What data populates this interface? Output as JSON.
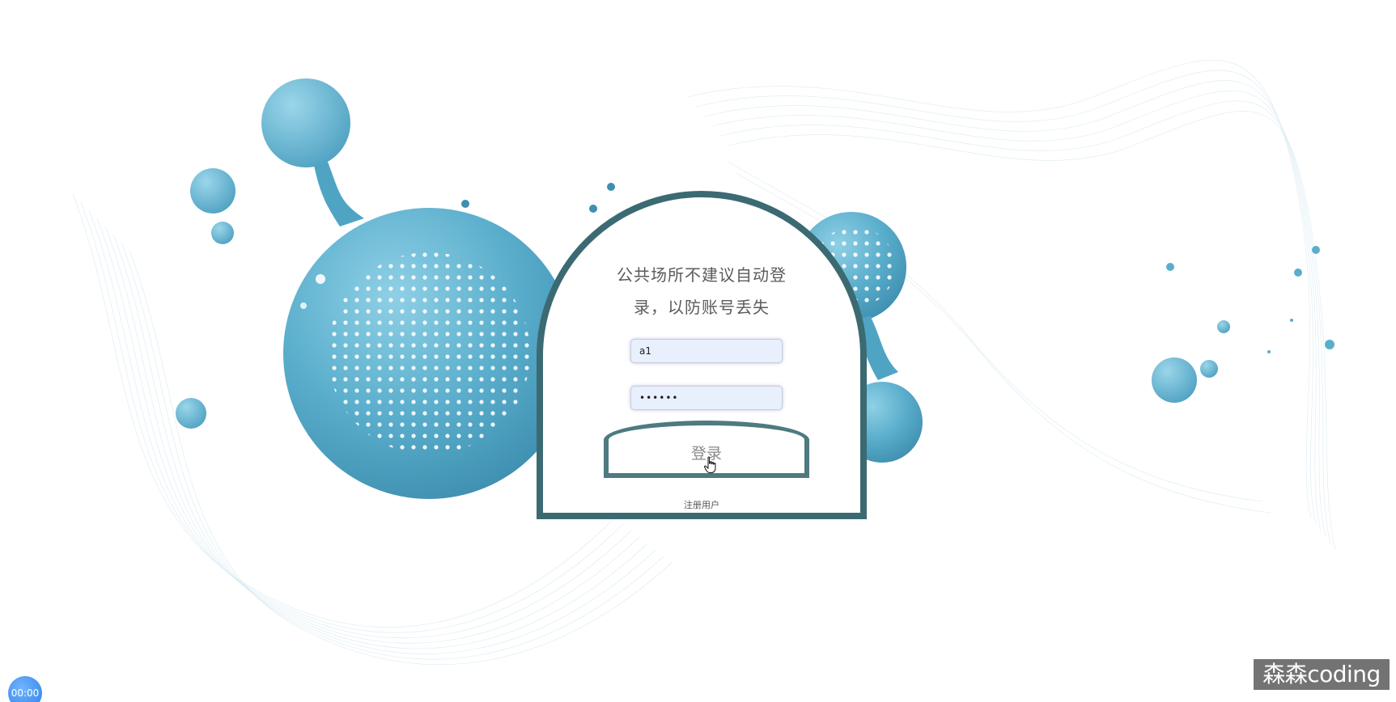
{
  "login": {
    "notice": "公共场所不建议自动登录，以防账号丢失",
    "username_value": "a1",
    "password_value": "••••••",
    "login_label": "登录",
    "register_label": "注册用户"
  },
  "timer": {
    "text": "00:00"
  },
  "watermark": {
    "text": "森森coding"
  },
  "colors": {
    "accent": "#5aaecc",
    "card_border": "#3c6a73",
    "button_border": "#4e7a80",
    "input_bg": "#e8f0fe"
  },
  "icons": {
    "cursor": "hand-pointer-icon"
  }
}
